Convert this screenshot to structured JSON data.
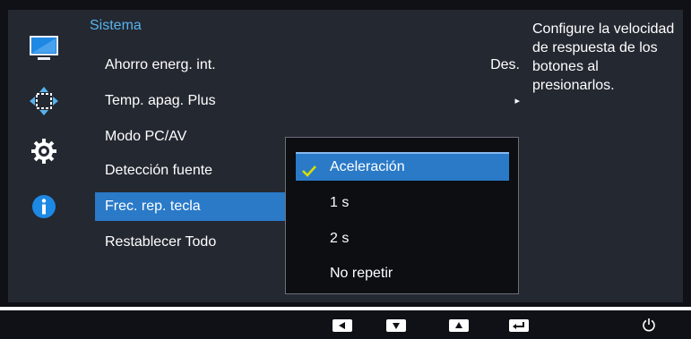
{
  "sidebar": {
    "icons": [
      "monitor-icon",
      "position-arrows-icon",
      "gear-icon",
      "info-icon"
    ]
  },
  "menu": {
    "title": "Sistema",
    "items": [
      {
        "label": "Ahorro energ. int.",
        "value": "Des."
      },
      {
        "label": "Temp. apag. Plus",
        "value": "▸"
      },
      {
        "label": "Modo PC/AV",
        "value": ""
      },
      {
        "label": "Detección fuente",
        "value": ""
      },
      {
        "label": "Frec. rep. tecla",
        "value": ""
      },
      {
        "label": "Restablecer Todo",
        "value": ""
      }
    ],
    "selected_index": 4
  },
  "dropdown": {
    "options": [
      "Aceleración",
      "1 s",
      "2 s",
      "No repetir"
    ],
    "selected_index": 0
  },
  "help": {
    "text": "Configure la velocidad de respuesta de los botones al presionarlos."
  },
  "bottom_bar": {
    "buttons": [
      "left-arrow-icon",
      "down-arrow-icon",
      "up-arrow-icon",
      "enter-icon",
      "power-icon"
    ]
  },
  "colors": {
    "accent": "#2a7ac8",
    "title": "#57b3ec",
    "panel": "#242831",
    "background": "#0f1116",
    "check": "#d7e000"
  }
}
